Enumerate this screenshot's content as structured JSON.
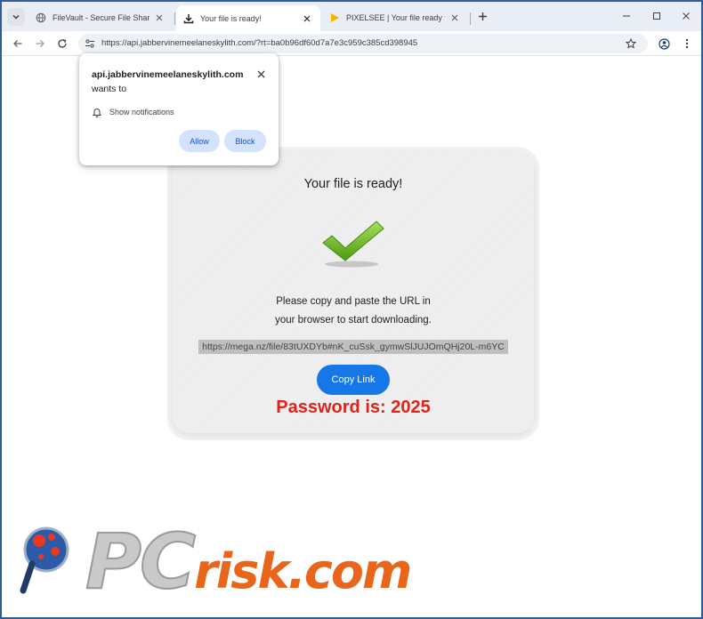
{
  "browser": {
    "tabs": [
      {
        "title": "FileVault - Secure File Sharing",
        "active": false,
        "icon": "globe-icon"
      },
      {
        "title": "Your file is ready!",
        "active": true,
        "icon": "download-icon"
      },
      {
        "title": "PIXELSEE | Your file ready to dow",
        "active": false,
        "icon": "play-icon"
      }
    ],
    "address": {
      "url": "https://api.jabbervinemeelaneskylith.com/?rt=ba0b96df60d7a7e3c959c385cd398945"
    }
  },
  "permission_popup": {
    "host": "api.jabbervinemeelaneskylith.com",
    "suffix": " wants to",
    "request": "Show notifications",
    "allow_label": "Allow",
    "block_label": "Block"
  },
  "page": {
    "title": "Your file is ready!",
    "instruction_line1": "Please copy and paste the URL in",
    "instruction_line2": "your browser to start downloading.",
    "link_url": "https://mega.nz/file/83tUXDYb#nK_cuSsk_gymwSlJUJOmQHj20L-m6YC",
    "copy_button": "Copy Link",
    "password_text": "Password is: 2025"
  },
  "watermark": {
    "text_pc": "PC",
    "text_risk": "risk",
    "text_com": ".com"
  },
  "colors": {
    "accent_button": "#1677e8",
    "password_red": "#e0231a",
    "permission_button": "#d3e3fd",
    "watermark_orange": "#e8651a"
  }
}
